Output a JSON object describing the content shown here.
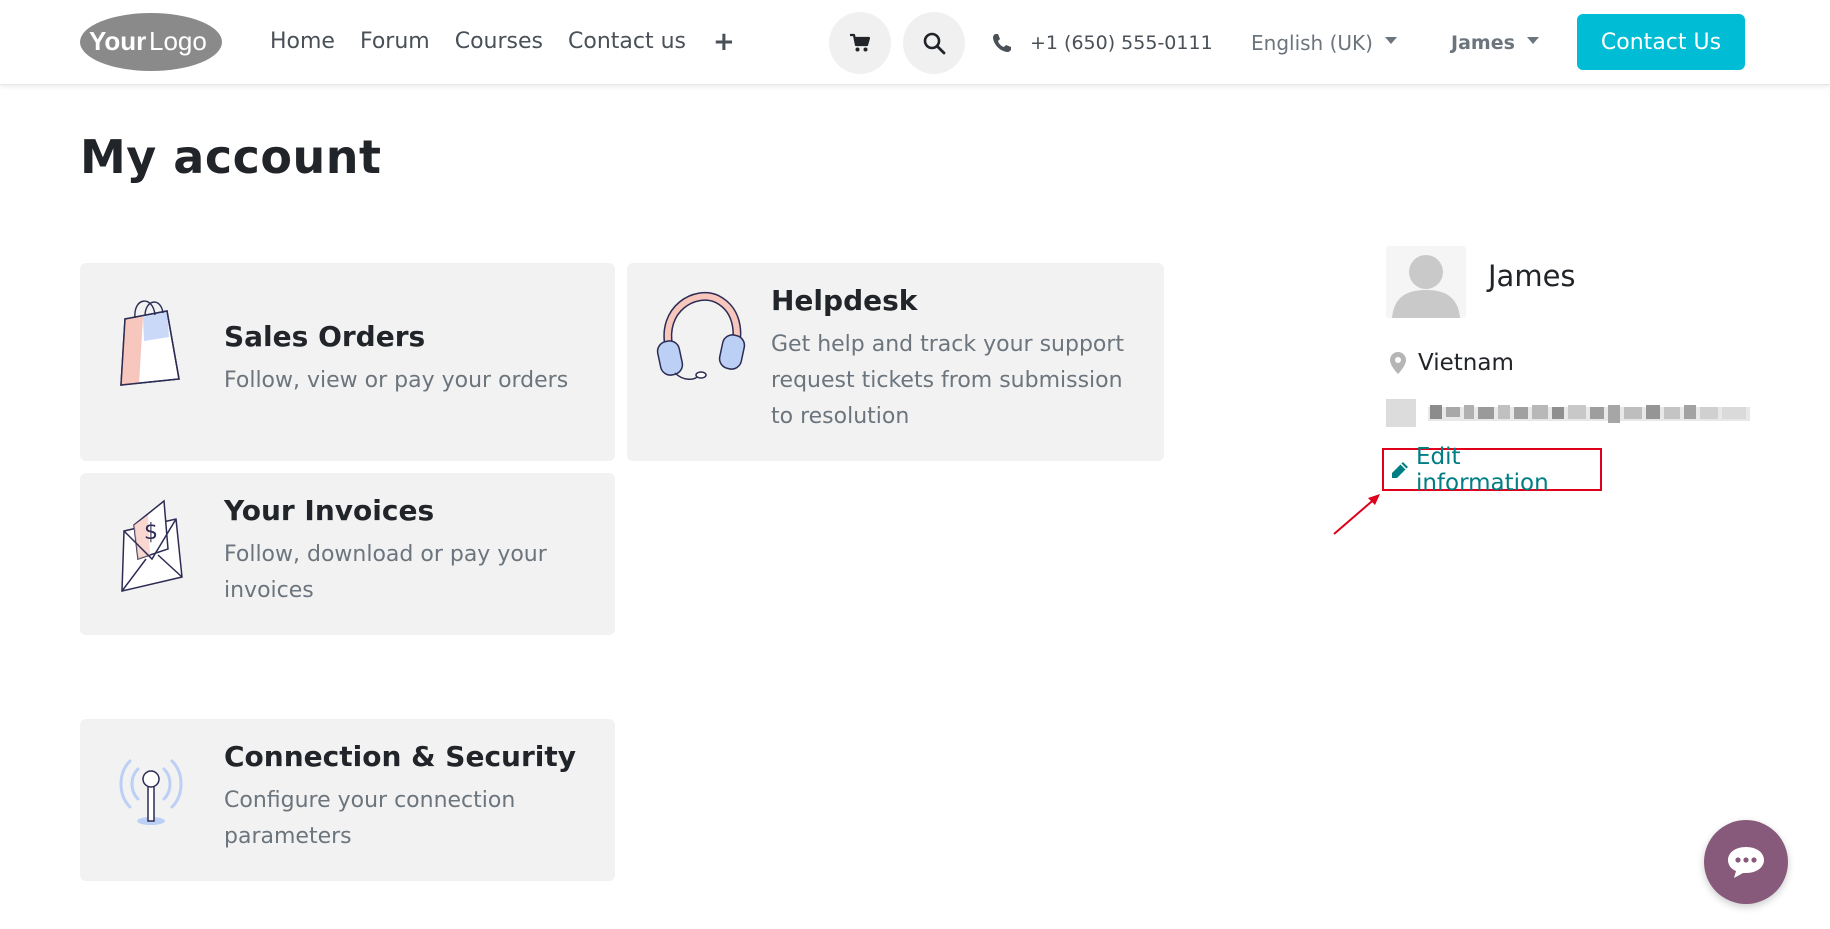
{
  "header": {
    "logo_text_bold": "Your",
    "logo_text_light": "Logo",
    "nav": [
      "Home",
      "Forum",
      "Courses",
      "Contact us"
    ],
    "add_symbol": "+",
    "phone": "+1 (650) 555-0111",
    "language": "English (UK)",
    "user": "James",
    "cta": "Contact Us"
  },
  "page": {
    "title": "My account"
  },
  "cards": {
    "sales": {
      "title": "Sales Orders",
      "desc": "Follow, view or pay your orders"
    },
    "helpdesk": {
      "title": "Helpdesk",
      "desc_lines": [
        "Get help and track your support",
        "request tickets from submission",
        "to resolution"
      ]
    },
    "invoices": {
      "title": "Your Invoices",
      "desc_lines": [
        "Follow, download or pay your",
        "invoices"
      ]
    },
    "security": {
      "title": "Connection & Security",
      "desc_lines": [
        "Configure your connection",
        "parameters"
      ]
    }
  },
  "profile": {
    "name": "James",
    "location": "Vietnam",
    "edit_label": "Edit information"
  },
  "colors": {
    "accent": "#00bcd4",
    "link": "#017e84",
    "highlight_box": "#e0001b",
    "chat": "#875a7b",
    "card_bg": "#f2f2f2"
  },
  "icons": [
    "cart-icon",
    "search-icon",
    "phone-icon",
    "map-marker-icon",
    "pencil-icon",
    "chat-icon"
  ]
}
